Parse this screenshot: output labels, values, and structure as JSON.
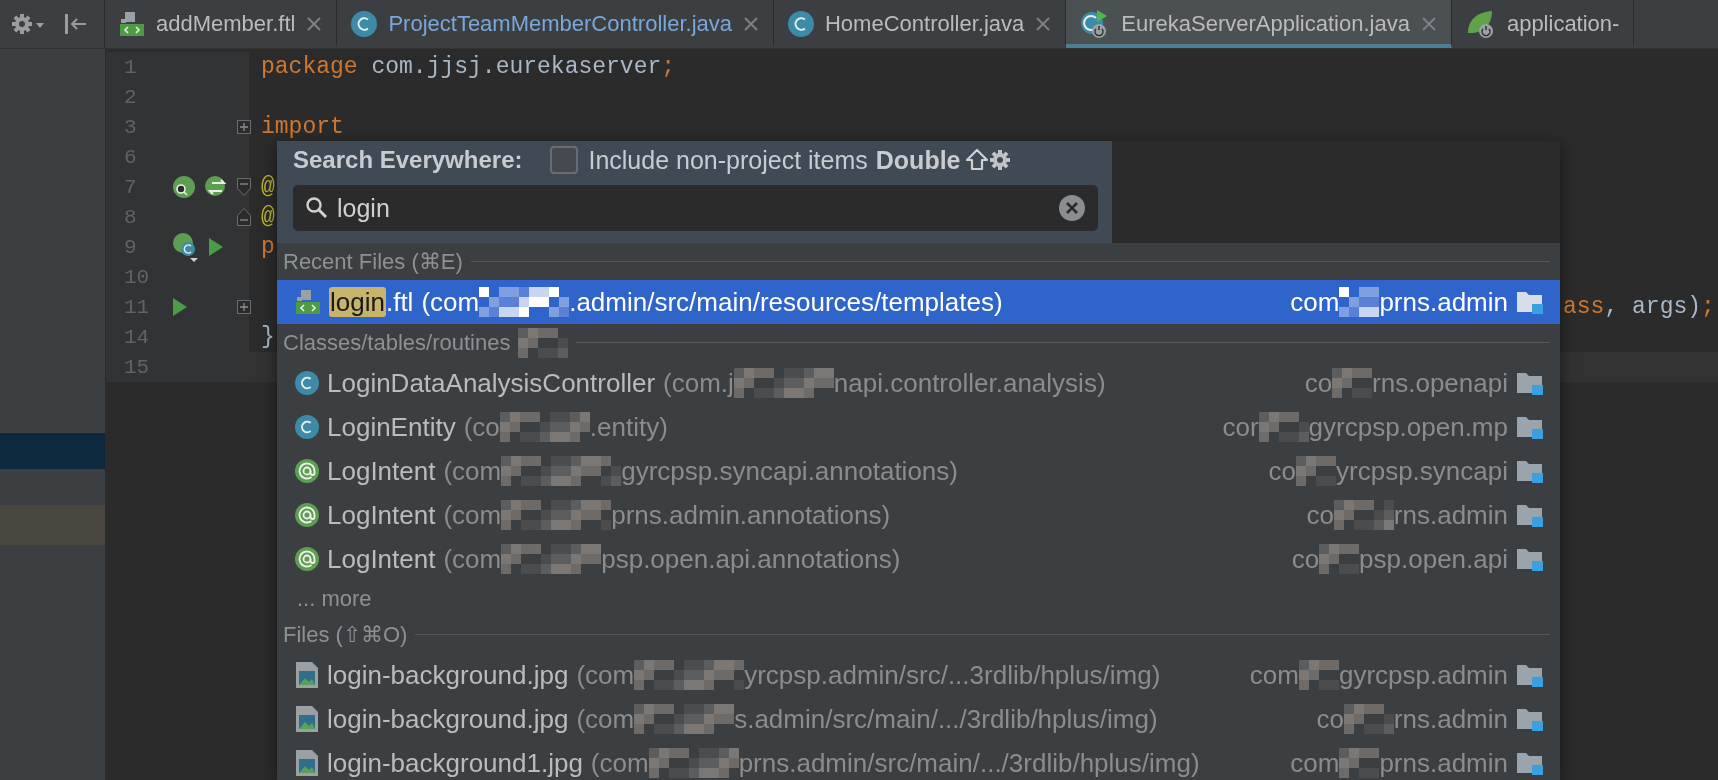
{
  "tabs": [
    {
      "label": "addMember.ftl",
      "kind": "ftl",
      "selected": false,
      "modified": false,
      "closable": true
    },
    {
      "label": "ProjectTeamMemberController.java",
      "kind": "class",
      "selected": false,
      "modified": true,
      "closable": true
    },
    {
      "label": "HomeController.java",
      "kind": "class",
      "selected": false,
      "modified": false,
      "closable": true
    },
    {
      "label": "EurekaServerApplication.java",
      "kind": "spring-run",
      "selected": true,
      "modified": false,
      "closable": true
    },
    {
      "label": "application-",
      "kind": "spring-config",
      "selected": false,
      "modified": false,
      "closable": false
    }
  ],
  "editor": {
    "lines": [
      {
        "number": "1",
        "code": [
          {
            "kind": "keyword",
            "text": "package"
          },
          {
            "kind": "plain",
            "text": " com.jjsj.eurekaserver"
          },
          {
            "kind": "keyword",
            "text": ";"
          }
        ]
      },
      {
        "number": "2"
      },
      {
        "number": "3",
        "fold": {
          "kind": "collapsed"
        },
        "code": [
          {
            "kind": "keyword",
            "text": "import"
          }
        ]
      },
      {
        "number": "6"
      },
      {
        "number": "7",
        "fold": {
          "kind": "start"
        },
        "gutter": [
          {
            "kind": "bean-search"
          },
          {
            "kind": "bean-swap"
          }
        ],
        "code": [
          {
            "kind": "annotation",
            "text": "@"
          }
        ]
      },
      {
        "number": "8",
        "fold": {
          "kind": "end"
        },
        "code": [
          {
            "kind": "annotation",
            "text": "@"
          }
        ]
      },
      {
        "number": "9",
        "gutter": [
          {
            "kind": "spring-class"
          },
          {
            "kind": "run"
          }
        ],
        "code": [
          {
            "kind": "keyword",
            "text": "p"
          }
        ]
      },
      {
        "number": "10"
      },
      {
        "number": "11",
        "fold": {
          "kind": "collapsed"
        },
        "gutter": [
          {
            "kind": "run"
          }
        ],
        "covered": true,
        "code": [
          {
            "kind": "keyword",
            "text": "ass"
          },
          {
            "kind": "plain",
            "text": ", args)"
          },
          {
            "kind": "keyword",
            "text": ";"
          }
        ]
      },
      {
        "number": "14",
        "code": [
          {
            "kind": "plain",
            "text": "}"
          }
        ]
      },
      {
        "number": "15",
        "caret": true
      }
    ]
  },
  "search": {
    "title": "Search Everywhere:",
    "include_label": "Include non-project items",
    "include_checked": false,
    "hint": "Double",
    "query": "login"
  },
  "sections": [
    {
      "title": "Recent Files (⌘E)",
      "redacted": false,
      "items": [
        {
          "kind": "ftl",
          "name_match": "login",
          "name": ".ftl",
          "path": [
            "(com",
            ".admin/src/main/resources/templates)"
          ],
          "module": [
            "com",
            "prns.admin"
          ],
          "selected": true
        }
      ]
    },
    {
      "title": "Classes/tables/routines",
      "redacted": true,
      "more": "... more",
      "items": [
        {
          "kind": "class",
          "name": "LoginDataAnalysisController",
          "path": [
            "(com.j",
            "napi.controller.analysis)"
          ],
          "module": [
            "co",
            "rns.openapi"
          ],
          "selected": false
        },
        {
          "kind": "class",
          "name": "LoginEntity",
          "path": [
            "(co",
            ".entity)"
          ],
          "module": [
            "cor",
            "gyrcpsp.open.mp"
          ],
          "selected": false
        },
        {
          "kind": "annotation",
          "name": "LogIntent",
          "path": [
            "(com",
            "gyrcpsp.syncapi.annotations)"
          ],
          "module": [
            "co",
            "yrcpsp.syncapi"
          ],
          "selected": false
        },
        {
          "kind": "annotation",
          "name": "LogIntent",
          "path": [
            "(com",
            "prns.admin.annotations)"
          ],
          "module": [
            "co",
            "rns.admin"
          ],
          "selected": false
        },
        {
          "kind": "annotation",
          "name": "LogIntent",
          "path": [
            "(com",
            "psp.open.api.annotations)"
          ],
          "module": [
            "co",
            "psp.open.api"
          ],
          "selected": false
        }
      ]
    },
    {
      "title": "Files (⇧⌘O)",
      "redacted": false,
      "items": [
        {
          "kind": "image",
          "name": "login-background.jpg",
          "path": [
            "(com",
            "yrcpsp.admin/src/...3rdlib/hplus/img)"
          ],
          "module": [
            "com",
            "gyrcpsp.admin"
          ],
          "selected": false
        },
        {
          "kind": "image",
          "name": "login-background.jpg",
          "path": [
            "(com",
            "s.admin/src/main/.../3rdlib/hplus/img)"
          ],
          "module": [
            "co",
            "rns.admin"
          ],
          "selected": false
        },
        {
          "kind": "image",
          "name": "login-background1.jpg",
          "path": [
            "(com",
            "prns.admin/src/main/.../3rdlib/hplus/img)"
          ],
          "module": [
            "com",
            "prns.admin"
          ],
          "selected": false
        }
      ]
    }
  ]
}
